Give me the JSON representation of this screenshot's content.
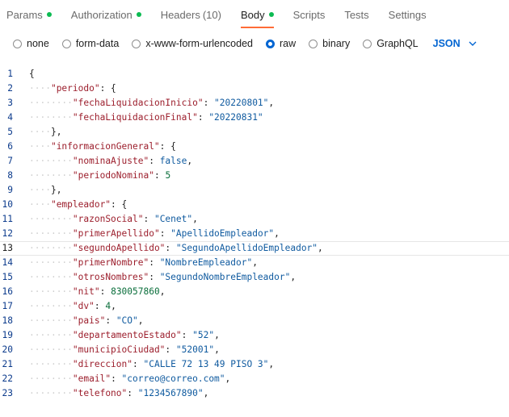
{
  "tabs": [
    {
      "label": "Params",
      "dot": true,
      "active": false
    },
    {
      "label": "Authorization",
      "dot": true,
      "active": false
    },
    {
      "label": "Headers",
      "count": "(10)",
      "active": false
    },
    {
      "label": "Body",
      "dot": true,
      "active": true
    },
    {
      "label": "Scripts",
      "active": false
    },
    {
      "label": "Tests",
      "active": false
    },
    {
      "label": "Settings",
      "active": false
    }
  ],
  "body_options": [
    {
      "label": "none",
      "checked": false
    },
    {
      "label": "form-data",
      "checked": false
    },
    {
      "label": "x-www-form-urlencoded",
      "checked": false
    },
    {
      "label": "raw",
      "checked": true
    },
    {
      "label": "binary",
      "checked": false
    },
    {
      "label": "GraphQL",
      "checked": false
    }
  ],
  "language": "JSON",
  "colors": {
    "accent": "#ff6c37",
    "status_dot": "#0cbb52",
    "link_blue": "#0265d2"
  },
  "editor": {
    "active_line": 13,
    "lines": [
      {
        "n": "1",
        "indent": 0,
        "tokens": [
          {
            "t": "{",
            "c": "pun"
          }
        ]
      },
      {
        "n": "2",
        "indent": 1,
        "tokens": [
          {
            "t": "\"periodo\"",
            "c": "key"
          },
          {
            "t": ": {",
            "c": "pun"
          }
        ]
      },
      {
        "n": "3",
        "indent": 2,
        "tokens": [
          {
            "t": "\"fechaLiquidacionInicio\"",
            "c": "key"
          },
          {
            "t": ": ",
            "c": "pun"
          },
          {
            "t": "\"20220801\"",
            "c": "str"
          },
          {
            "t": ",",
            "c": "pun"
          }
        ]
      },
      {
        "n": "4",
        "indent": 2,
        "tokens": [
          {
            "t": "\"fechaLiquidacionFinal\"",
            "c": "key"
          },
          {
            "t": ": ",
            "c": "pun"
          },
          {
            "t": "\"20220831\"",
            "c": "str"
          }
        ]
      },
      {
        "n": "5",
        "indent": 1,
        "tokens": [
          {
            "t": "},",
            "c": "pun"
          }
        ]
      },
      {
        "n": "6",
        "indent": 1,
        "tokens": [
          {
            "t": "\"informacionGeneral\"",
            "c": "key"
          },
          {
            "t": ": {",
            "c": "pun"
          }
        ]
      },
      {
        "n": "7",
        "indent": 2,
        "tokens": [
          {
            "t": "\"nominaAjuste\"",
            "c": "key"
          },
          {
            "t": ": ",
            "c": "pun"
          },
          {
            "t": "false",
            "c": "kw"
          },
          {
            "t": ",",
            "c": "pun"
          }
        ]
      },
      {
        "n": "8",
        "indent": 2,
        "tokens": [
          {
            "t": "\"periodoNomina\"",
            "c": "key"
          },
          {
            "t": ": ",
            "c": "pun"
          },
          {
            "t": "5",
            "c": "num"
          }
        ]
      },
      {
        "n": "9",
        "indent": 1,
        "tokens": [
          {
            "t": "},",
            "c": "pun"
          }
        ]
      },
      {
        "n": "10",
        "indent": 1,
        "tokens": [
          {
            "t": "\"empleador\"",
            "c": "key"
          },
          {
            "t": ": {",
            "c": "pun"
          }
        ]
      },
      {
        "n": "11",
        "indent": 2,
        "tokens": [
          {
            "t": "\"razonSocial\"",
            "c": "key"
          },
          {
            "t": ": ",
            "c": "pun"
          },
          {
            "t": "\"Cenet\"",
            "c": "str"
          },
          {
            "t": ",",
            "c": "pun"
          }
        ]
      },
      {
        "n": "12",
        "indent": 2,
        "tokens": [
          {
            "t": "\"primerApellido\"",
            "c": "key"
          },
          {
            "t": ": ",
            "c": "pun"
          },
          {
            "t": "\"ApellidoEmpleador\"",
            "c": "str"
          },
          {
            "t": ",",
            "c": "pun"
          }
        ]
      },
      {
        "n": "13",
        "indent": 2,
        "tokens": [
          {
            "t": "\"segundoApellido\"",
            "c": "key"
          },
          {
            "t": ": ",
            "c": "pun"
          },
          {
            "t": "\"SegundoApellidoEmpleador\"",
            "c": "str"
          },
          {
            "t": ",",
            "c": "pun"
          }
        ]
      },
      {
        "n": "14",
        "indent": 2,
        "tokens": [
          {
            "t": "\"primerNombre\"",
            "c": "key"
          },
          {
            "t": ": ",
            "c": "pun"
          },
          {
            "t": "\"NombreEmpleador\"",
            "c": "str"
          },
          {
            "t": ",",
            "c": "pun"
          }
        ]
      },
      {
        "n": "15",
        "indent": 2,
        "tokens": [
          {
            "t": "\"otrosNombres\"",
            "c": "key"
          },
          {
            "t": ": ",
            "c": "pun"
          },
          {
            "t": "\"SegundoNombreEmpleador\"",
            "c": "str"
          },
          {
            "t": ",",
            "c": "pun"
          }
        ]
      },
      {
        "n": "16",
        "indent": 2,
        "tokens": [
          {
            "t": "\"nit\"",
            "c": "key"
          },
          {
            "t": ": ",
            "c": "pun"
          },
          {
            "t": "830057860",
            "c": "num"
          },
          {
            "t": ",",
            "c": "pun"
          }
        ]
      },
      {
        "n": "17",
        "indent": 2,
        "tokens": [
          {
            "t": "\"dv\"",
            "c": "key"
          },
          {
            "t": ": ",
            "c": "pun"
          },
          {
            "t": "4",
            "c": "num"
          },
          {
            "t": ",",
            "c": "pun"
          }
        ]
      },
      {
        "n": "18",
        "indent": 2,
        "tokens": [
          {
            "t": "\"pais\"",
            "c": "key"
          },
          {
            "t": ": ",
            "c": "pun"
          },
          {
            "t": "\"CO\"",
            "c": "str"
          },
          {
            "t": ",",
            "c": "pun"
          }
        ]
      },
      {
        "n": "19",
        "indent": 2,
        "tokens": [
          {
            "t": "\"departamentoEstado\"",
            "c": "key"
          },
          {
            "t": ": ",
            "c": "pun"
          },
          {
            "t": "\"52\"",
            "c": "str"
          },
          {
            "t": ",",
            "c": "pun"
          }
        ]
      },
      {
        "n": "20",
        "indent": 2,
        "tokens": [
          {
            "t": "\"municipioCiudad\"",
            "c": "key"
          },
          {
            "t": ": ",
            "c": "pun"
          },
          {
            "t": "\"52001\"",
            "c": "str"
          },
          {
            "t": ",",
            "c": "pun"
          }
        ]
      },
      {
        "n": "21",
        "indent": 2,
        "tokens": [
          {
            "t": "\"direccion\"",
            "c": "key"
          },
          {
            "t": ": ",
            "c": "pun"
          },
          {
            "t": "\"CALLE 72 13 49 PISO 3\"",
            "c": "str"
          },
          {
            "t": ",",
            "c": "pun"
          }
        ]
      },
      {
        "n": "22",
        "indent": 2,
        "tokens": [
          {
            "t": "\"email\"",
            "c": "key"
          },
          {
            "t": ": ",
            "c": "pun"
          },
          {
            "t": "\"correo@correo.com\"",
            "c": "str"
          },
          {
            "t": ",",
            "c": "pun"
          }
        ]
      },
      {
        "n": "23",
        "indent": 2,
        "tokens": [
          {
            "t": "\"telefono\"",
            "c": "key"
          },
          {
            "t": ": ",
            "c": "pun"
          },
          {
            "t": "\"1234567890\"",
            "c": "str"
          },
          {
            "t": ",",
            "c": "pun"
          }
        ]
      }
    ]
  }
}
